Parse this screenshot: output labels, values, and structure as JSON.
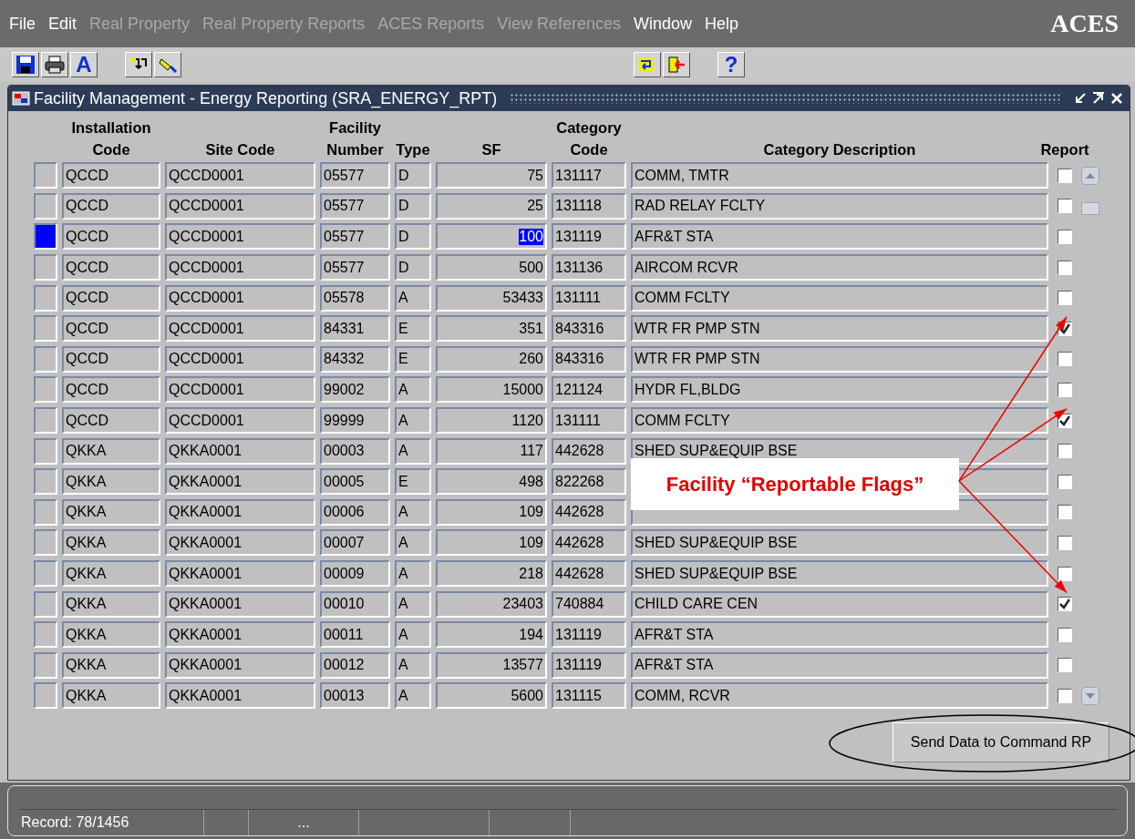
{
  "menu": [
    {
      "label": "File",
      "disabled": false
    },
    {
      "label": "Edit",
      "disabled": false
    },
    {
      "label": "Real Property",
      "disabled": true
    },
    {
      "label": "Real Property Reports",
      "disabled": true
    },
    {
      "label": "ACES Reports",
      "disabled": true
    },
    {
      "label": "View References",
      "disabled": true
    },
    {
      "label": "Window",
      "disabled": false
    },
    {
      "label": "Help",
      "disabled": false
    }
  ],
  "app_logo": "ACES",
  "toolbar": {
    "font_button": "A",
    "help_button": "?"
  },
  "window": {
    "title": "Facility Management - Energy Reporting (SRA_ENERGY_RPT)"
  },
  "columns": [
    "Installation\nCode",
    "Site Code",
    "Facility\nNumber",
    "Type",
    "SF",
    "Category\nCode",
    "Category Description",
    "Report"
  ],
  "rows": [
    {
      "selected": false,
      "cells": [
        "QCCD",
        "QCCD0001",
        "05577",
        "D",
        "75",
        "131117",
        "COMM, TMTR"
      ],
      "report": false
    },
    {
      "selected": false,
      "cells": [
        "QCCD",
        "QCCD0001",
        "05577",
        "D",
        "25",
        "131118",
        "RAD RELAY FCLTY"
      ],
      "report": false
    },
    {
      "selected": true,
      "cells": [
        "QCCD",
        "QCCD0001",
        "05577",
        "D",
        "100",
        "131119",
        "AFR&T STA"
      ],
      "report": false
    },
    {
      "selected": false,
      "cells": [
        "QCCD",
        "QCCD0001",
        "05577",
        "D",
        "500",
        "131136",
        "AIRCOM RCVR"
      ],
      "report": false
    },
    {
      "selected": false,
      "cells": [
        "QCCD",
        "QCCD0001",
        "05578",
        "A",
        "53433",
        "131111",
        "COMM FCLTY"
      ],
      "report": false
    },
    {
      "selected": false,
      "cells": [
        "QCCD",
        "QCCD0001",
        "84331",
        "E",
        "351",
        "843316",
        "WTR FR PMP STN"
      ],
      "report": true
    },
    {
      "selected": false,
      "cells": [
        "QCCD",
        "QCCD0001",
        "84332",
        "E",
        "260",
        "843316",
        "WTR FR PMP STN"
      ],
      "report": false
    },
    {
      "selected": false,
      "cells": [
        "QCCD",
        "QCCD0001",
        "99002",
        "A",
        "15000",
        "121124",
        "HYDR FL,BLDG"
      ],
      "report": false
    },
    {
      "selected": false,
      "cells": [
        "QCCD",
        "QCCD0001",
        "99999",
        "A",
        "1120",
        "131111",
        "COMM FCLTY"
      ],
      "report": true
    },
    {
      "selected": false,
      "cells": [
        "QKKA",
        "QKKA0001",
        "00003",
        "A",
        "117",
        "442628",
        "SHED SUP&EQUIP BSE"
      ],
      "report": false
    },
    {
      "selected": false,
      "cells": [
        "QKKA",
        "QKKA0001",
        "00005",
        "E",
        "498",
        "822268"
      ],
      "report": false
    },
    {
      "selected": false,
      "cells": [
        "QKKA",
        "QKKA0001",
        "00006",
        "A",
        "109",
        "442628"
      ],
      "report": false
    },
    {
      "selected": false,
      "cells": [
        "QKKA",
        "QKKA0001",
        "00007",
        "A",
        "109",
        "442628",
        "SHED SUP&EQUIP BSE"
      ],
      "report": false
    },
    {
      "selected": false,
      "cells": [
        "QKKA",
        "QKKA0001",
        "00009",
        "A",
        "218",
        "442628",
        "SHED SUP&EQUIP BSE"
      ],
      "report": false
    },
    {
      "selected": false,
      "cells": [
        "QKKA",
        "QKKA0001",
        "00010",
        "A",
        "23403",
        "740884",
        "CHILD CARE CEN"
      ],
      "report": true
    },
    {
      "selected": false,
      "cells": [
        "QKKA",
        "QKKA0001",
        "00011",
        "A",
        "194",
        "131119",
        "AFR&T STA"
      ],
      "report": false
    },
    {
      "selected": false,
      "cells": [
        "QKKA",
        "QKKA0001",
        "00012",
        "A",
        "13577",
        "131119",
        "AFR&T STA"
      ],
      "report": false
    },
    {
      "selected": false,
      "cells": [
        "QKKA",
        "QKKA0001",
        "00013",
        "A",
        "5600",
        "131115",
        "COMM, RCVR"
      ],
      "report": false
    }
  ],
  "annotation": {
    "label": "Facility “Reportable Flags”"
  },
  "send_button": "Send Data to Command RP",
  "status_bar": {
    "record": "Record: 78/1456",
    "field_4": "..."
  }
}
